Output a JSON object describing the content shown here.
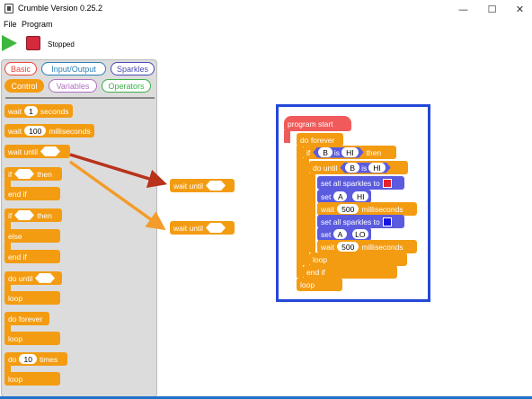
{
  "window": {
    "title": "Crumble Version 0.25.2",
    "minimize": "—",
    "maximize": "☐",
    "close": "✕"
  },
  "menu": {
    "file": "File",
    "program": "Program"
  },
  "toolbar": {
    "status": "Stopped"
  },
  "palette": {
    "tabs": {
      "basic": "Basic",
      "input_output": "Input/Output",
      "sparkles": "Sparkles",
      "control": "Control",
      "variables": "Variables",
      "operators": "Operators"
    },
    "blocks": {
      "wait_label": "wait",
      "wait_seconds_value": "1",
      "seconds": "seconds",
      "wait_ms_value": "100",
      "milliseconds": "milliseconds",
      "wait_until": "wait until",
      "if": "if",
      "then": "then",
      "end_if": "end if",
      "else": "else",
      "do_until": "do until",
      "loop": "loop",
      "do_forever": "do forever",
      "do": "do",
      "times_value": "10",
      "times": "times"
    }
  },
  "canvas": {
    "dragged_1": "wait until",
    "dragged_2": "wait until",
    "program": {
      "start": "program start",
      "do_forever": "do forever",
      "if": "if",
      "var_b": "B",
      "is": "is",
      "hi": "HI",
      "then": "then",
      "do_until": "do until",
      "set_all_sparkles_1": "set all sparkles to",
      "set_a_hi_set": "set",
      "var_a": "A",
      "wait_1": "wait",
      "wait_1_value": "500",
      "milliseconds": "milliseconds",
      "set_all_sparkles_2": "set all sparkles to",
      "set_a_lo_set": "set",
      "lo": "LO",
      "wait_2": "wait",
      "wait_2_value": "500",
      "inner_loop": "loop",
      "end_if": "end if",
      "outer_loop": "loop"
    }
  },
  "colors": {
    "block_orange": "#f39c12",
    "condition_purple": "#5b5be0",
    "hat_red": "#f05a5a",
    "frame_blue": "#2448d8",
    "sparkle_red": "#e8222a",
    "sparkle_blue": "#1515e0",
    "arrow_red": "#b8321c",
    "arrow_orange": "#f39c2a"
  },
  "icons": {
    "play": "play-icon",
    "stop": "stop-icon",
    "app": "crumble-app-icon"
  }
}
